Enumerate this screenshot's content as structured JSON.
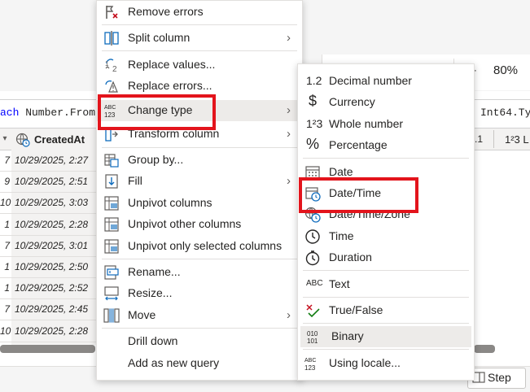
{
  "background": {
    "zoom_minus": "-",
    "zoom_level": "80%",
    "formula_left_kw": "ach",
    "formula_left_rest": " Number.From",
    "formula_right": "Int64.Ty",
    "column_header": "CreatedAt",
    "column_header_right": "1²3 L",
    "column_header_right_prefix": ".1",
    "row_numbers": [
      "7",
      "9",
      "10",
      "1",
      "7",
      "1",
      "1",
      "7",
      "10"
    ],
    "row_dates": [
      "10/29/2025, 2:27",
      "10/29/2025, 2:51",
      "10/29/2025, 3:03",
      "10/29/2025, 2:28",
      "10/29/2025, 3:01",
      "10/29/2025, 2:50",
      "10/29/2025, 2:52",
      "10/29/2025, 2:45",
      "10/29/2025, 2:28"
    ],
    "step_label": "Step"
  },
  "main_menu": {
    "items": [
      {
        "label": "Remove errors",
        "icon": "remove-errors-icon"
      },
      {
        "label": "Split column",
        "icon": "split-column-icon",
        "submenu": true
      },
      {
        "label": "Replace values...",
        "icon": "replace-values-icon"
      },
      {
        "label": "Replace errors...",
        "icon": "replace-errors-icon"
      },
      {
        "label": "Change type",
        "icon": "change-type-icon",
        "submenu": true,
        "highlighted": true
      },
      {
        "label": "Transform column",
        "icon": "transform-column-icon",
        "submenu": true
      },
      {
        "label": "Group by...",
        "icon": "group-by-icon"
      },
      {
        "label": "Fill",
        "icon": "fill-icon",
        "submenu": true
      },
      {
        "label": "Unpivot columns",
        "icon": "unpivot-columns-icon"
      },
      {
        "label": "Unpivot other columns",
        "icon": "unpivot-other-icon"
      },
      {
        "label": "Unpivot only selected columns",
        "icon": "unpivot-selected-icon"
      },
      {
        "label": "Rename...",
        "icon": "rename-icon"
      },
      {
        "label": "Resize...",
        "icon": "resize-icon"
      },
      {
        "label": "Move",
        "icon": "move-icon",
        "submenu": true
      },
      {
        "label": "Drill down",
        "icon": ""
      },
      {
        "label": "Add as new query",
        "icon": ""
      }
    ]
  },
  "sub_menu": {
    "items": [
      {
        "label": "Decimal number",
        "icon": "decimal-icon",
        "glyph": "1.2"
      },
      {
        "label": "Currency",
        "icon": "currency-icon",
        "glyph": "$"
      },
      {
        "label": "Whole number",
        "icon": "whole-number-icon",
        "glyph": "1²3"
      },
      {
        "label": "Percentage",
        "icon": "percentage-icon",
        "glyph": "%"
      },
      {
        "label": "Date",
        "icon": "date-icon"
      },
      {
        "label": "Date/Time",
        "icon": "datetime-icon"
      },
      {
        "label": "Date/Time/Zone",
        "icon": "datetime-zone-icon"
      },
      {
        "label": "Time",
        "icon": "time-icon"
      },
      {
        "label": "Duration",
        "icon": "duration-icon"
      },
      {
        "label": "Text",
        "icon": "text-icon",
        "glyph": "ABC"
      },
      {
        "label": "True/False",
        "icon": "true-false-icon"
      },
      {
        "label": "Binary",
        "icon": "binary-icon",
        "glyph": "010 101",
        "hover": true
      },
      {
        "label": "Using locale...",
        "icon": "using-locale-icon",
        "glyph": "ABC 123"
      }
    ]
  },
  "colors": {
    "highlight_box": "#e3141c",
    "accent_blue": "#0f6cbd"
  }
}
